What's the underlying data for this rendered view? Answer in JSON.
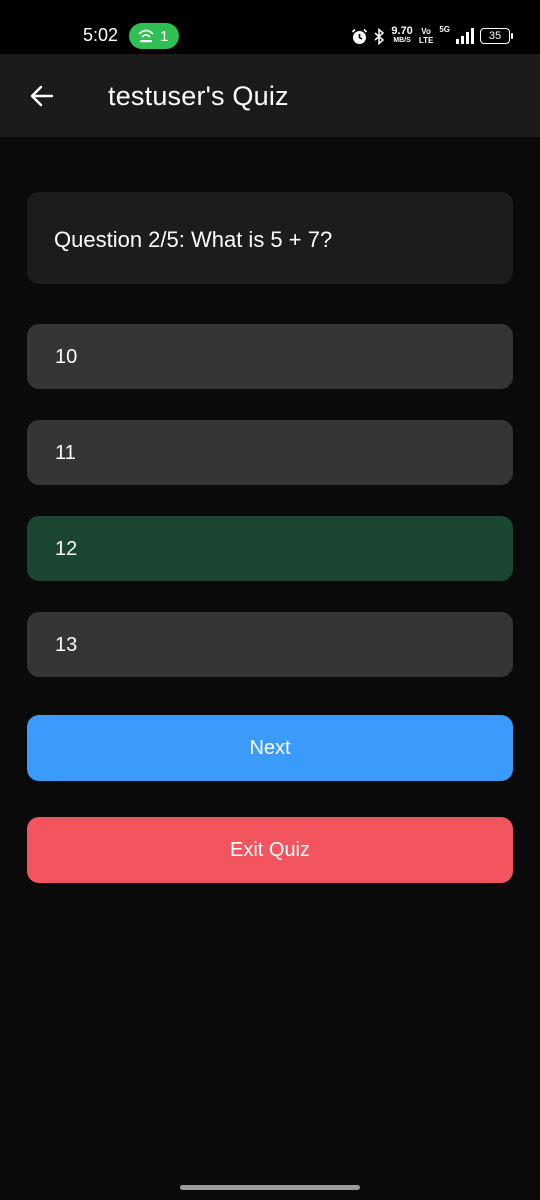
{
  "status_bar": {
    "time": "5:02",
    "hotspot_count": "1",
    "net_speed_value": "9.70",
    "net_speed_unit": "MB/S",
    "volte_top": "Vo",
    "volte_bottom": "LTE",
    "network_type": "5G",
    "battery": "35",
    "icons": [
      "hotspot-icon",
      "alarm-icon",
      "bluetooth-icon",
      "signal-icon",
      "battery-icon"
    ]
  },
  "app_bar": {
    "title": "testuser's Quiz",
    "back_icon": "arrow-left-icon"
  },
  "question": {
    "text": "Question 2/5: What is 5 + 7?"
  },
  "options": [
    {
      "label": "10",
      "selected": false
    },
    {
      "label": "11",
      "selected": false
    },
    {
      "label": "12",
      "selected": true
    },
    {
      "label": "13",
      "selected": false
    }
  ],
  "buttons": {
    "next_label": "Next",
    "exit_label": "Exit Quiz"
  },
  "colors": {
    "background": "#0a0a0a",
    "app_bar": "#1b1b1b",
    "option": "#353535",
    "option_selected": "#1b4631",
    "next": "#3a9bfb",
    "exit": "#f2555e",
    "hotspot": "#2fbf52"
  }
}
